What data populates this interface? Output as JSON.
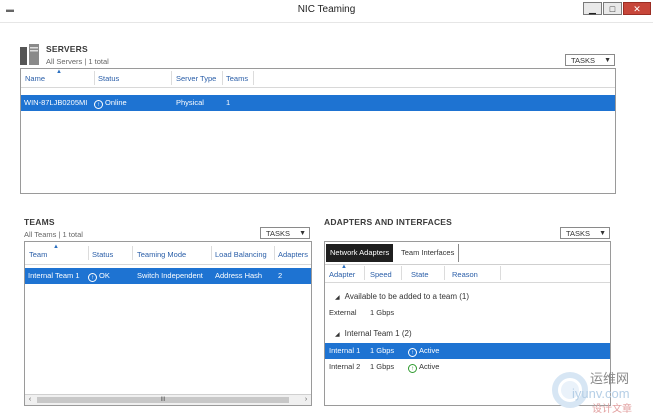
{
  "window": {
    "title": "NIC Teaming",
    "min_label": "▁",
    "max_label": "□",
    "close_label": "✕"
  },
  "servers": {
    "title": "SERVERS",
    "subtitle": "All Servers | 1 total",
    "tasks_label": "TASKS",
    "columns": [
      "Name",
      "Status",
      "Server Type",
      "Teams"
    ],
    "rows": [
      {
        "name": "WIN-87LJB0205MI",
        "status": "Online",
        "server_type": "Physical",
        "teams": "1"
      }
    ]
  },
  "teams": {
    "title": "TEAMS",
    "subtitle": "All Teams | 1 total",
    "tasks_label": "TASKS",
    "columns": [
      "Team",
      "Status",
      "Teaming Mode",
      "Load Balancing",
      "Adapters"
    ],
    "rows": [
      {
        "team": "Internal Team 1",
        "status": "OK",
        "mode": "Switch Independent",
        "lb": "Address Hash",
        "adapters": "2"
      }
    ],
    "scroll_left": "‹",
    "scroll_mid": "III",
    "scroll_right": "›"
  },
  "adapters": {
    "title": "ADAPTERS AND INTERFACES",
    "tasks_label": "TASKS",
    "tabs": [
      "Network Adapters",
      "Team Interfaces"
    ],
    "columns": [
      "Adapter",
      "Speed",
      "State",
      "Reason"
    ],
    "group1": {
      "label": "Available to be added to a team (1)",
      "rows": [
        {
          "adapter": "External",
          "speed": "1 Gbps",
          "state": ""
        }
      ]
    },
    "group2": {
      "label": "Internal Team 1 (2)",
      "rows": [
        {
          "adapter": "Internal 1",
          "speed": "1 Gbps",
          "state": "Active"
        },
        {
          "adapter": "Internal 2",
          "speed": "1 Gbps",
          "state": "Active"
        }
      ]
    }
  },
  "watermark": {
    "text1": "运维网",
    "text2": "iyunv.com",
    "text3": "设计文章"
  }
}
